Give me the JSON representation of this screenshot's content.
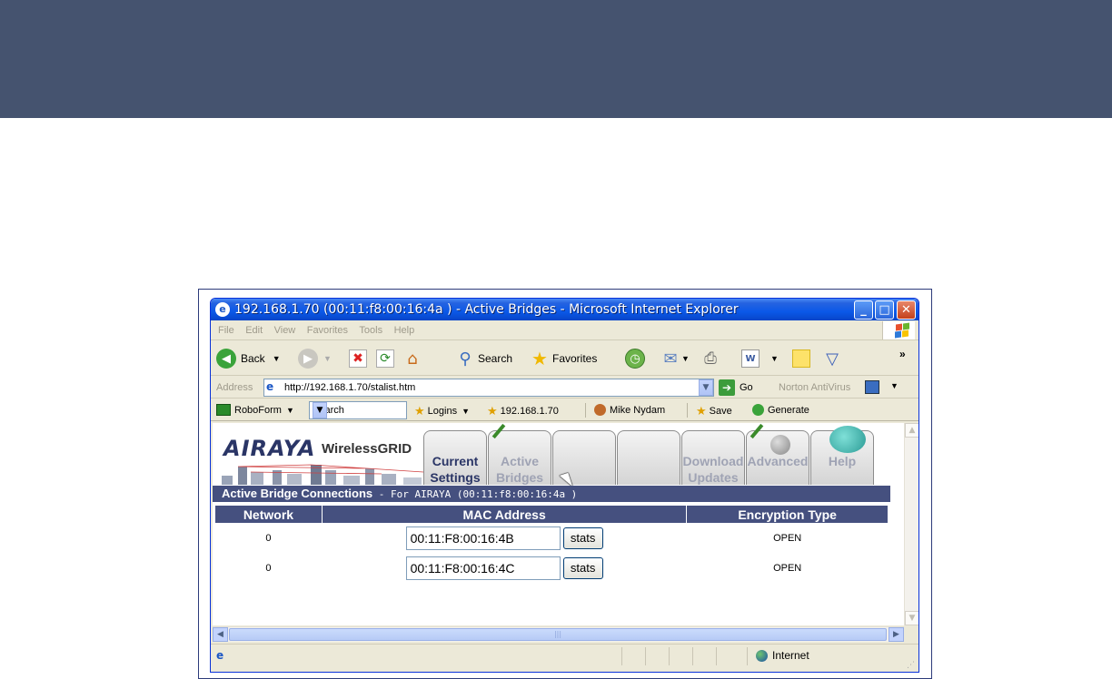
{
  "window": {
    "title": "192.168.1.70 (00:11:f8:00:16:4a ) - Active Bridges - Microsoft Internet Explorer"
  },
  "menu": [
    "File",
    "Edit",
    "View",
    "Favorites",
    "Tools",
    "Help"
  ],
  "toolbar": {
    "back_label": "Back",
    "search_label": "Search",
    "favorites_label": "Favorites"
  },
  "address": {
    "label": "Address",
    "url": "http://192.168.1.70/stalist.htm",
    "go_label": "Go",
    "norton_label": "Norton AntiVirus"
  },
  "roboform": {
    "label": "RoboForm",
    "search_value": "Search",
    "logins_label": "Logins",
    "host_label": "192.168.1.70",
    "user_label": "Mike Nydam",
    "save_label": "Save",
    "generate_label": "Generate"
  },
  "page": {
    "logo": "AIRAYA",
    "logo_sub": "WirelessGRID",
    "tabs": [
      {
        "line1": "Current",
        "line2": "Settings"
      },
      {
        "line1": "Active",
        "line2": "Bridges"
      },
      {
        "line1": "",
        "line2": ""
      },
      {
        "line1": "",
        "line2": ""
      },
      {
        "line1": "Download",
        "line2": "Updates"
      },
      {
        "line1": "",
        "line2": "Advanced"
      },
      {
        "line1": "",
        "line2": "Help"
      }
    ],
    "section_title": "Active Bridge Connections",
    "section_sub": " - For AIRAYA (00:11:f8:00:16:4a )",
    "table": {
      "headers": [
        "Network",
        "MAC Address",
        "Encryption Type"
      ],
      "rows": [
        {
          "network": "0",
          "mac": "00:11:F8:00:16:4B",
          "stats": "stats",
          "encryption": "OPEN"
        },
        {
          "network": "0",
          "mac": "00:11:F8:00:16:4C",
          "stats": "stats",
          "encryption": "OPEN"
        }
      ]
    }
  },
  "status": {
    "zone": "Internet"
  }
}
